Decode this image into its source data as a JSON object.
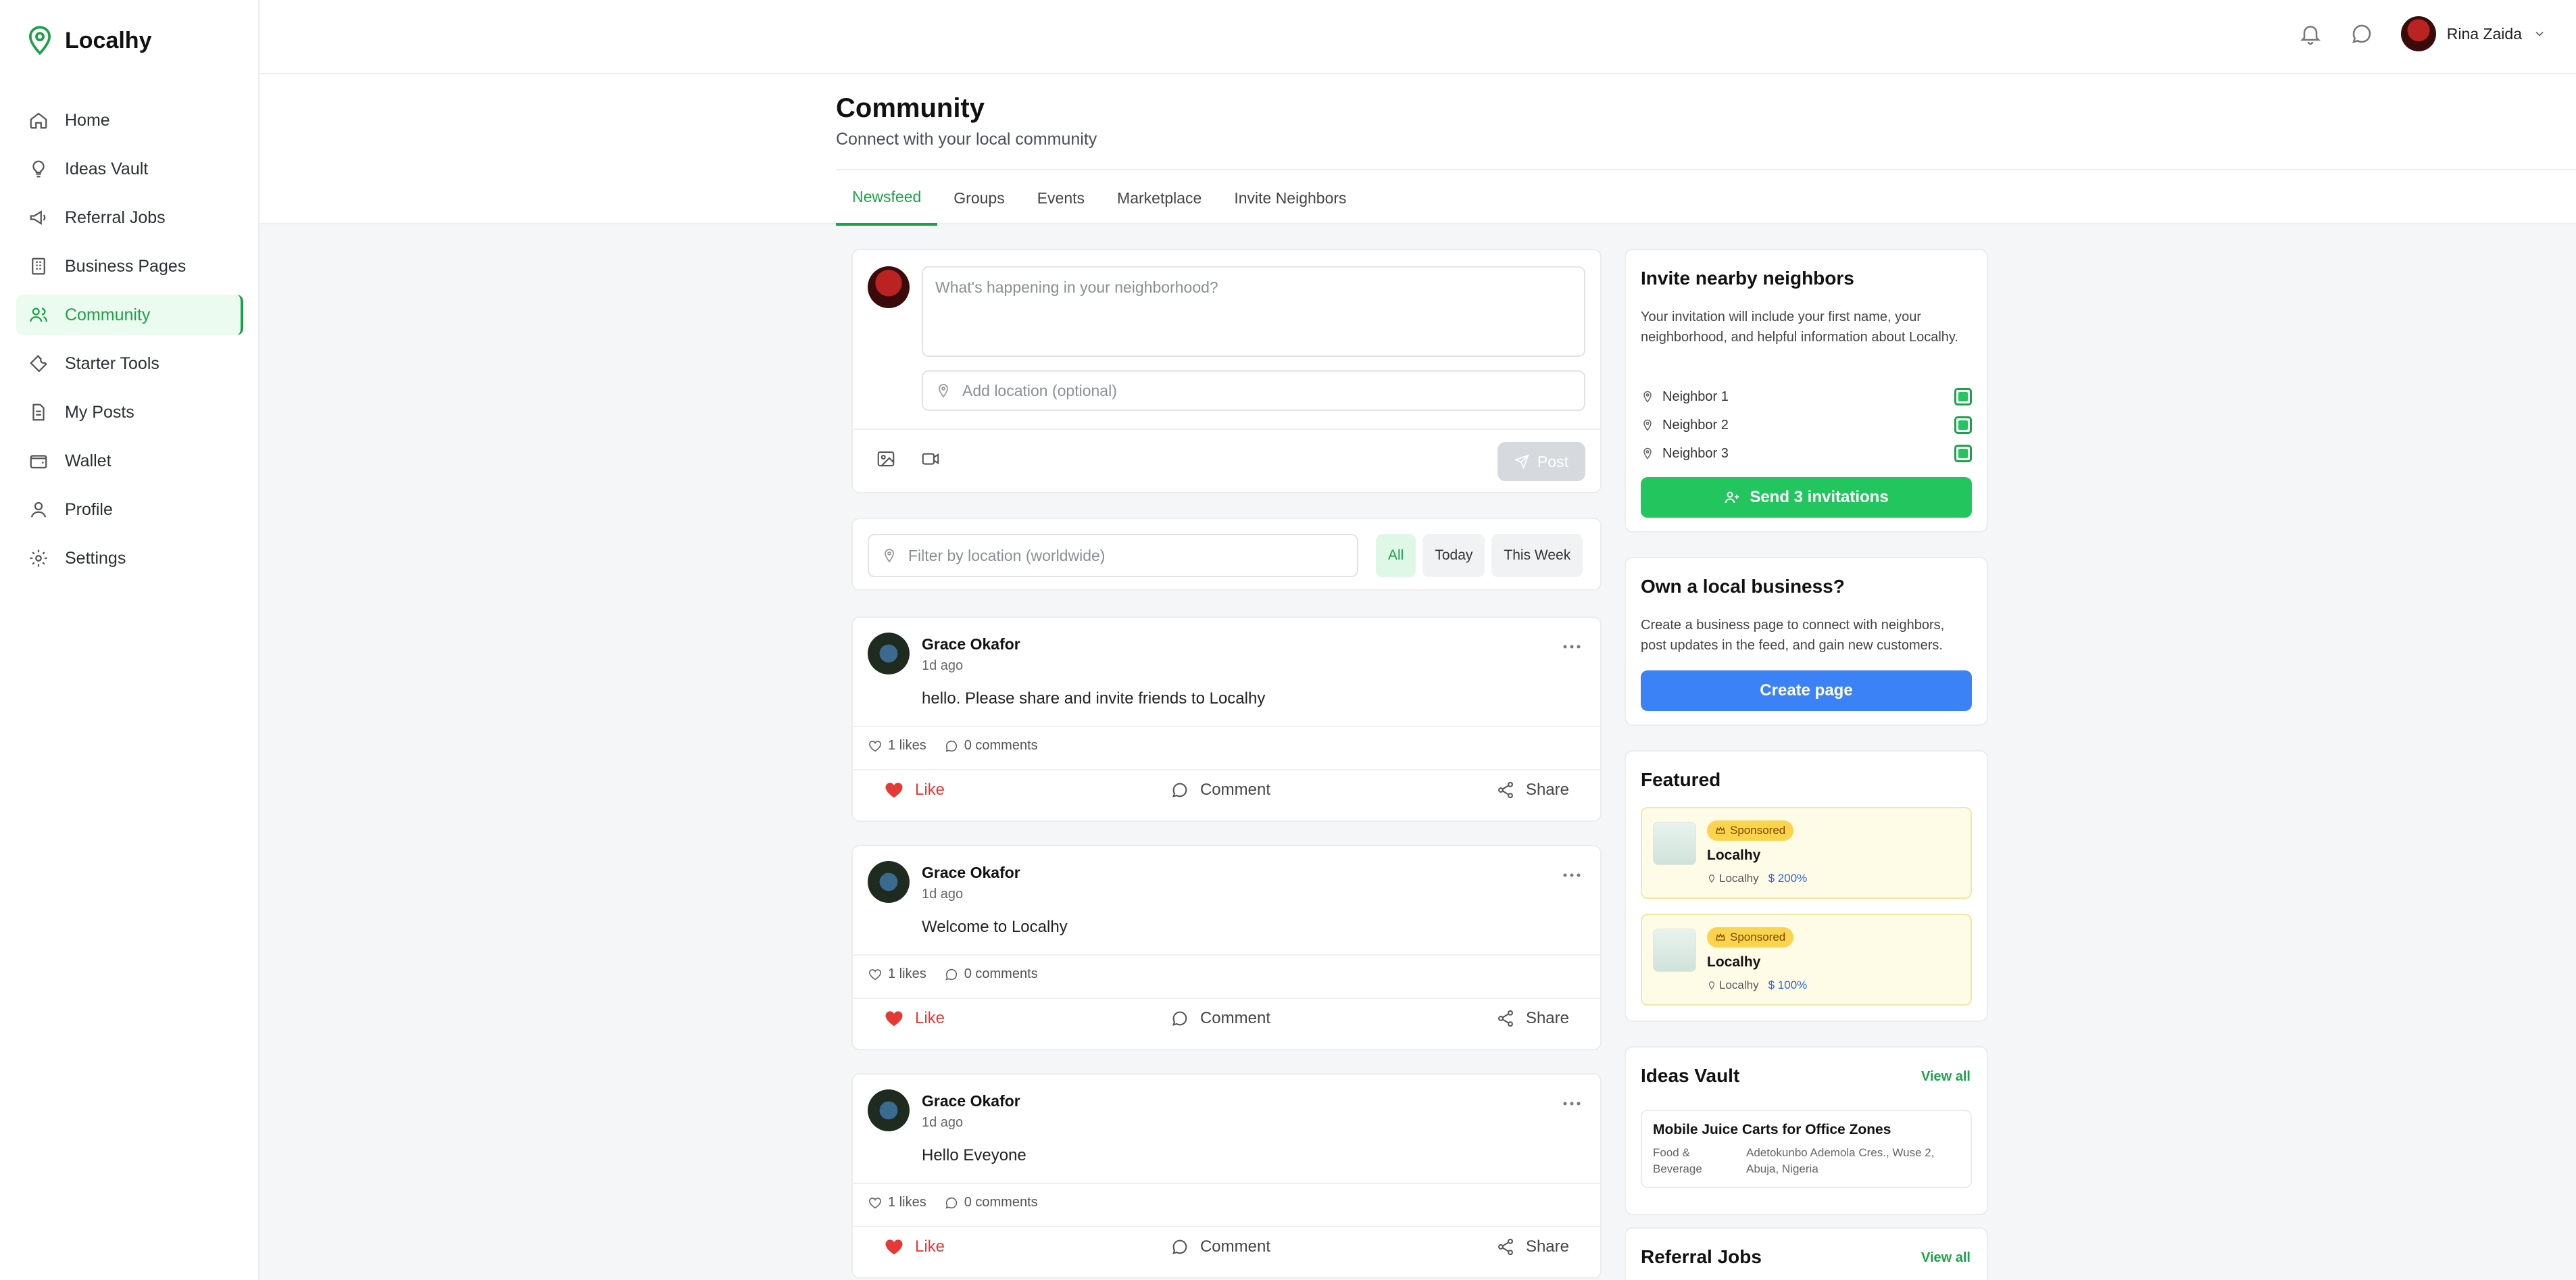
{
  "app": {
    "name": "Localhy"
  },
  "sidebar": {
    "items": [
      {
        "label": "Home",
        "icon": "home-icon"
      },
      {
        "label": "Ideas Vault",
        "icon": "lightbulb-icon"
      },
      {
        "label": "Referral Jobs",
        "icon": "megaphone-icon"
      },
      {
        "label": "Business Pages",
        "icon": "building-icon"
      },
      {
        "label": "Community",
        "icon": "users-icon",
        "active": true
      },
      {
        "label": "Starter Tools",
        "icon": "wrench-icon"
      },
      {
        "label": "My Posts",
        "icon": "document-icon"
      },
      {
        "label": "Wallet",
        "icon": "wallet-icon"
      },
      {
        "label": "Profile",
        "icon": "user-icon"
      },
      {
        "label": "Settings",
        "icon": "gear-icon"
      }
    ]
  },
  "topbar": {
    "user_name": "Rina Zaida"
  },
  "header": {
    "title": "Community",
    "subtitle": "Connect with your local community",
    "tabs": [
      "Newsfeed",
      "Groups",
      "Events",
      "Marketplace",
      "Invite Neighbors"
    ]
  },
  "composer": {
    "placeholder": "What's happening in your neighborhood?",
    "location_placeholder": "Add location (optional)",
    "post_label": "Post"
  },
  "filter": {
    "placeholder": "Filter by location (worldwide)",
    "chips": [
      "All",
      "Today",
      "This Week"
    ]
  },
  "posts": [
    {
      "author": "Grace Okafor",
      "time": "1d ago",
      "text": "hello. Please share and invite friends to Localhy",
      "likes": "1 likes",
      "comments": "0 comments"
    },
    {
      "author": "Grace Okafor",
      "time": "1d ago",
      "text": "Welcome to Localhy",
      "likes": "1 likes",
      "comments": "0 comments"
    },
    {
      "author": "Grace Okafor",
      "time": "1d ago",
      "text": "Hello Eveyone",
      "likes": "1 likes",
      "comments": "0 comments"
    }
  ],
  "post_actions": {
    "like": "Like",
    "comment": "Comment",
    "share": "Share"
  },
  "invite": {
    "title": "Invite nearby neighbors",
    "description": "Your invitation will include your first name, your neighborhood, and helpful information about Localhy.",
    "neighbors": [
      "Neighbor 1",
      "Neighbor 2",
      "Neighbor 3"
    ],
    "button": "Send 3 invitations"
  },
  "business": {
    "title": "Own a local business?",
    "description": "Create a business page to connect with neighbors, post updates in the feed, and gain new customers.",
    "button": "Create page"
  },
  "featured": {
    "title": "Featured",
    "items": [
      {
        "badge": "Sponsored",
        "name": "Localhy",
        "location": "Localhy",
        "amount": "200%"
      },
      {
        "badge": "Sponsored",
        "name": "Localhy",
        "location": "Localhy",
        "amount": "100%"
      }
    ]
  },
  "ideas": {
    "title": "Ideas Vault",
    "view_all": "View all",
    "item": {
      "title": "Mobile Juice Carts for Office Zones",
      "category": "Food & Beverage",
      "address": "Adetokunbo Ademola Cres., Wuse 2, Abuja, Nigeria"
    }
  },
  "referral": {
    "title": "Referral Jobs",
    "view_all": "View all"
  },
  "colors": {
    "accent_green": "#1ca14a",
    "button_green": "#22c55e",
    "button_blue": "#3b82f6",
    "like_red": "#e53935"
  }
}
